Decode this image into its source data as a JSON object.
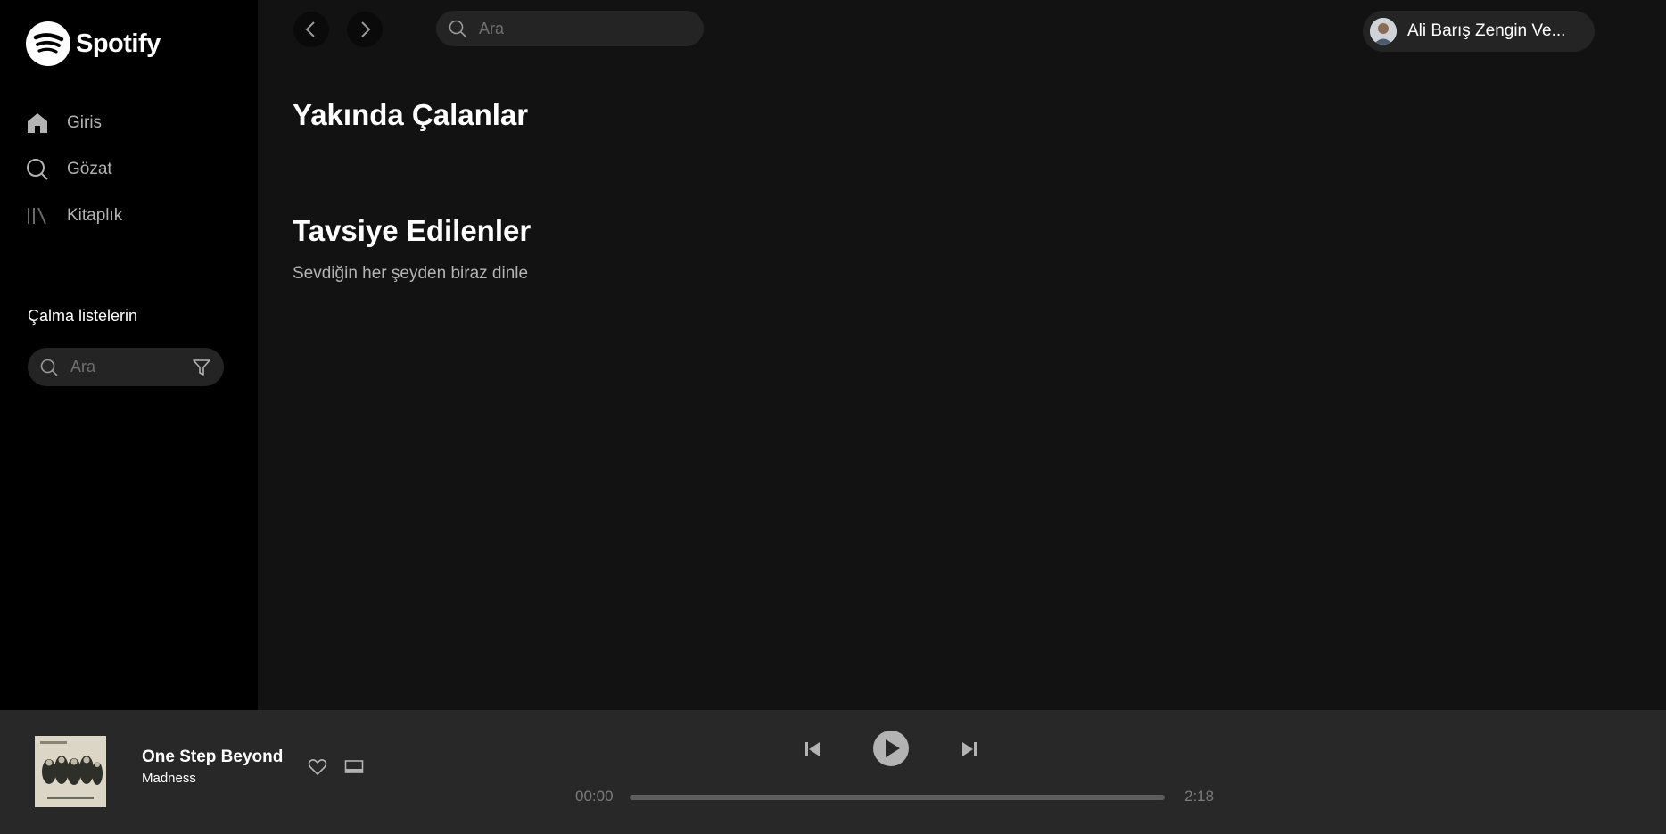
{
  "sidebar": {
    "logo_text": "Spotify",
    "nav": [
      {
        "label": "Giris",
        "icon": "home-icon"
      },
      {
        "label": "Gözat",
        "icon": "search-icon"
      },
      {
        "label": "Kitaplık",
        "icon": "library-icon"
      }
    ],
    "playlists_title": "Çalma listelerin",
    "playlists_search_placeholder": "Ara"
  },
  "topbar": {
    "search_placeholder": "Ara",
    "user_name": "Ali Barış Zengin Ve..."
  },
  "main": {
    "recent_title": "Yakında Çalanlar",
    "recommended_title": "Tavsiye Edilenler",
    "recommended_subtitle": "Sevdiğin her şeyden biraz dinle"
  },
  "player": {
    "track_title": "One Step Beyond",
    "track_artist": "Madness",
    "current_time": "00:00",
    "total_time": "2:18",
    "progress": 0
  },
  "colors": {
    "background": "#121212",
    "sidebar": "#000000",
    "player": "#282828",
    "input": "#242424",
    "muted_text": "#b3b3b3"
  }
}
